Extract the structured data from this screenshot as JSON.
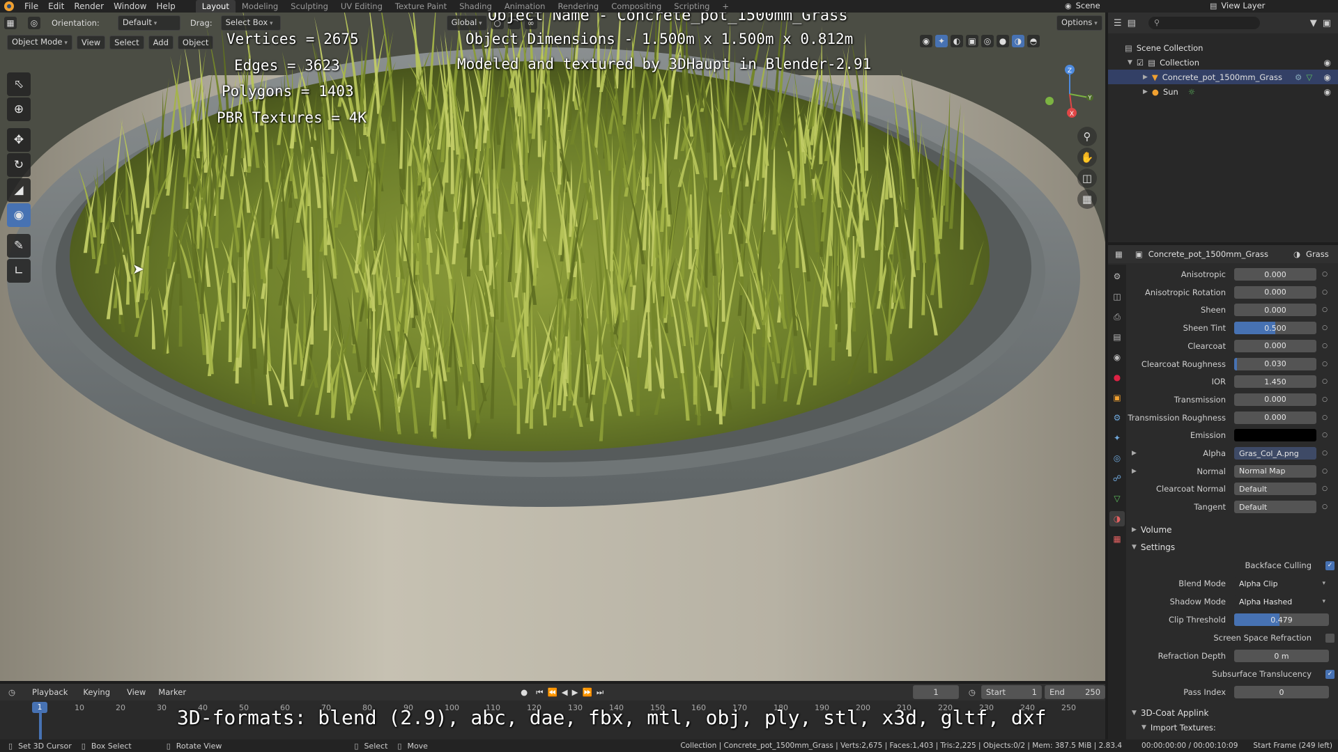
{
  "menu": {
    "items": [
      "File",
      "Edit",
      "Render",
      "Window",
      "Help"
    ]
  },
  "workspaces": {
    "tabs": [
      "Layout",
      "Modeling",
      "Sculpting",
      "UV Editing",
      "Texture Paint",
      "Shading",
      "Animation",
      "Rendering",
      "Compositing",
      "Scripting"
    ],
    "active": "Layout"
  },
  "topright": {
    "scene": "Scene",
    "view_layer": "View Layer"
  },
  "viewport_header": {
    "orientation_label": "Orientation:",
    "orientation_value": "Default",
    "drag_label": "Drag:",
    "drag_value": "Select Box",
    "transform_orientation": "Global",
    "options": "Options",
    "mode": "Object Mode",
    "view": "View",
    "select": "Select",
    "add": "Add",
    "object": "Object"
  },
  "overlay": {
    "object_name": "Object Name - Concrete_pot_1500mm_Grass",
    "dimensions": "Object Dimensions -  1.500m x 1.500m x 0.812m",
    "credit": "Modeled and textured by 3DHaupt in Blender-2.91",
    "vertices": "Vertices = 2675",
    "edges": "Edges = 3623",
    "polygons": "Polygons = 1403",
    "textures": "PBR Textures = 4K",
    "formats": "3D-formats: blend (2.9), abc, dae, fbx, mtl, obj, ply, stl, x3d, gltf, dxf"
  },
  "gizmo": {
    "x": "X",
    "y": "Y",
    "z": "Z"
  },
  "outliner": {
    "scene_collection": "Scene Collection",
    "collection": "Collection",
    "object": "Concrete_pot_1500mm_Grass",
    "sun": "Sun"
  },
  "properties": {
    "header_object": "Concrete_pot_1500mm_Grass",
    "header_material": "Grass",
    "rows": [
      {
        "label": "Anisotropic",
        "value": "0.000"
      },
      {
        "label": "Anisotropic Rotation",
        "value": "0.000"
      },
      {
        "label": "Sheen",
        "value": "0.000"
      },
      {
        "label": "Sheen Tint",
        "value": "0.500",
        "fill": 0.5
      },
      {
        "label": "Clearcoat",
        "value": "0.000"
      },
      {
        "label": "Clearcoat Roughness",
        "value": "0.030",
        "fill": 0.03
      },
      {
        "label": "IOR",
        "value": "1.450"
      },
      {
        "label": "Transmission",
        "value": "0.000"
      },
      {
        "label": "Transmission Roughness",
        "value": "0.000"
      },
      {
        "label": "Emission",
        "value": ""
      },
      {
        "label": "Alpha",
        "value": "Gras_Col_A.png"
      },
      {
        "label": "Normal",
        "value": "Normal Map"
      },
      {
        "label": "Clearcoat Normal",
        "value": "Default"
      },
      {
        "label": "Tangent",
        "value": "Default"
      }
    ],
    "volume": "Volume",
    "settings": "Settings",
    "backface_culling": "Backface Culling",
    "blend_mode_label": "Blend Mode",
    "blend_mode": "Alpha Clip",
    "shadow_mode_label": "Shadow Mode",
    "shadow_mode": "Alpha Hashed",
    "clip_threshold_label": "Clip Threshold",
    "clip_threshold": "0.479",
    "clip_fill": 0.479,
    "ssr_label": "Screen Space Refraction",
    "refraction_depth_label": "Refraction Depth",
    "refraction_depth": "0 m",
    "sss_label": "Subsurface Translucency",
    "pass_index_label": "Pass Index",
    "pass_index": "0",
    "applink": "3D-Coat Applink",
    "import_textures": "Import Textures:"
  },
  "timeline": {
    "playback": "Playback",
    "keying": "Keying",
    "view": "View",
    "marker": "Marker",
    "current_frame": "1",
    "start_label": "Start",
    "start": "1",
    "end_label": "End",
    "end": "250",
    "ticks": [
      "1",
      "10",
      "20",
      "30",
      "40",
      "50",
      "60",
      "70",
      "80",
      "90",
      "100",
      "110",
      "120",
      "130",
      "140",
      "150",
      "160",
      "170",
      "180",
      "190",
      "200",
      "210",
      "220",
      "230",
      "240",
      "250"
    ]
  },
  "statusbar": {
    "set_cursor": "Set 3D Cursor",
    "box_select": "Box Select",
    "rotate": "Rotate View",
    "select": "Select",
    "move": "Move",
    "stats": "Collection | Concrete_pot_1500mm_Grass | Verts:2,675 | Faces:1,403 | Tris:2,225 | Objects:0/2 | Mem: 387.5 MiB | 2.83.4",
    "time": "00:00:00:00 / 00:00:10:09",
    "start_frame": "Start Frame (249 left)"
  }
}
